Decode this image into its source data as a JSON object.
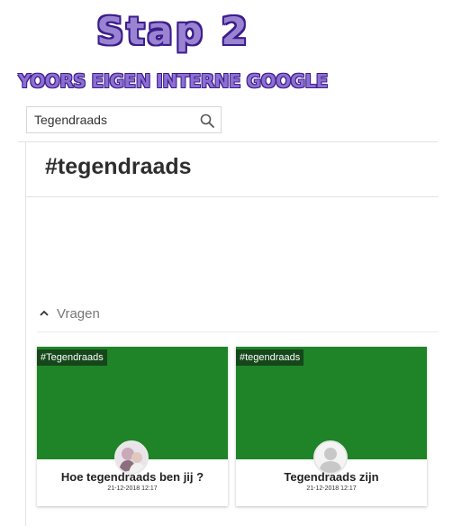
{
  "banner": {
    "title": "Stap 2",
    "subtitle": "YOORS EIGEN INTERNE GOOGLE",
    "colors": {
      "title_fill": "#9a84d2",
      "title_outline": "#3c1d8c",
      "subtitle_fill": "#8e6ed3"
    }
  },
  "search": {
    "value": "Tegendraads",
    "icon": "search-icon"
  },
  "page": {
    "title": "#tegendraads"
  },
  "section": {
    "label": "Vragen",
    "icon": "chevron-up-icon"
  },
  "cards": [
    {
      "tag": "#Tegendraads",
      "title": "Hoe tegendraads ben jij ?",
      "date": "21-12-2018 12:17",
      "avatar": "user-photo-avatar",
      "image_color": "#1e8427"
    },
    {
      "tag": "#tegendraads",
      "title": "Tegendraads zijn",
      "date": "21-12-2018 12:17",
      "avatar": "default-user-avatar",
      "image_color": "#1e8427"
    }
  ]
}
